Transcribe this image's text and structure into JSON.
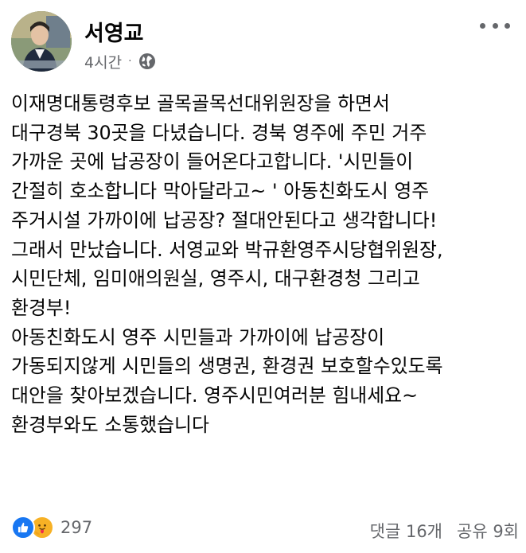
{
  "post": {
    "author": "서영교",
    "time": "4시간",
    "separator": "·",
    "privacy_icon": "globe-icon",
    "more_icon": "more-options-icon",
    "lines": [
      "이재명대통령후보 골목골목선대위원장을 하면서",
      "대구경북 30곳을 다녔습니다. 경북 영주에 주민 거주",
      "가까운 곳에 납공장이 들어온다고합니다. '시민들이",
      "간절히 호소합니다 막아달라고~ ' 아동친화도시 영주",
      "주거시설 가까이에 납공장? 절대안된다고 생각합니다!",
      "그래서 만났습니다. 서영교와 박규환영주시당협위원장,",
      "시민단체, 임미애의원실, 영주시, 대구환경청 그리고",
      "환경부!",
      "아동친화도시 영주 시민들과 가까이에 납공장이",
      "가동되지않게 시민들의 생명권, 환경권 보호할수있도록",
      "대안을 찾아보겠습니다. 영주시민여러분 힘내세요~",
      "환경부와도 소통했습니다"
    ]
  },
  "footer": {
    "reaction_icons": [
      "like-icon",
      "care-icon"
    ],
    "reaction_count": "297",
    "comments": "댓글 16개",
    "shares": "공유 9회"
  },
  "colors": {
    "text": "#050505",
    "secondary": "#65676b",
    "like_blue": "#1877f2",
    "care_yellow": "#f7b125"
  }
}
